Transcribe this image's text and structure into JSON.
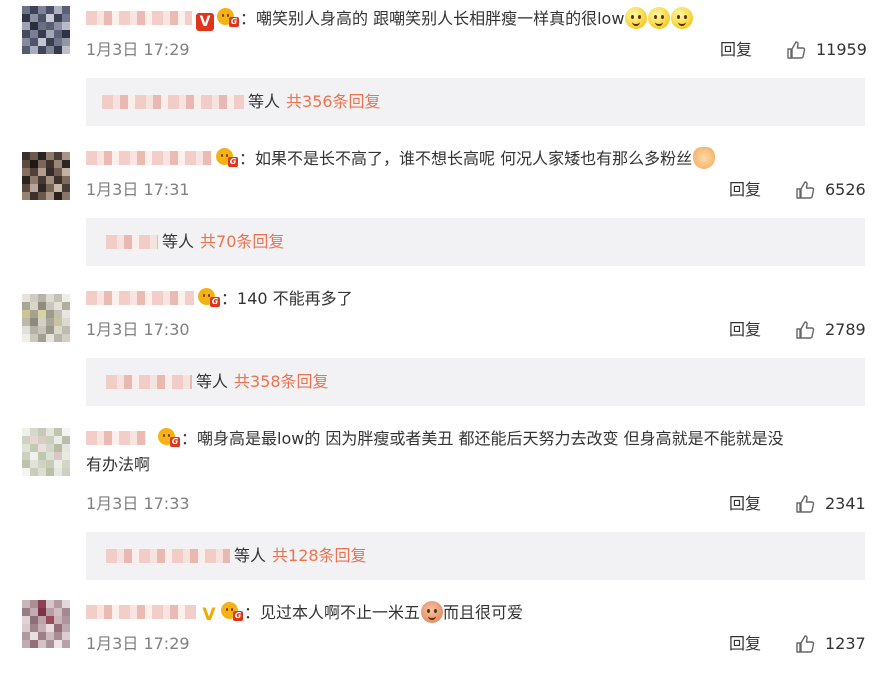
{
  "comments": [
    {
      "text": "嘲笑别人身高的 跟嘲笑别人长相胖瘦一样真的很low",
      "time": "1月3日 17:29",
      "reply_label": "回复",
      "likes": "11959",
      "sub": {
        "suffix": "等人",
        "total": "共356条回复"
      }
    },
    {
      "text": "如果不是长不高了，谁不想长高呢 何况人家矮也有那么多粉丝",
      "time": "1月3日 17:31",
      "reply_label": "回复",
      "likes": "6526",
      "sub": {
        "suffix": "等人",
        "total": "共70条回复"
      }
    },
    {
      "text": "140 不能再多了",
      "time": "1月3日 17:30",
      "reply_label": "回复",
      "likes": "2789",
      "sub": {
        "suffix": "等人",
        "total": "共358条回复"
      }
    },
    {
      "text_line1": "嘲身高是最low的  因为胖瘦或者美丑  都还能后天努力去改变  但身高就是不能就是没",
      "text_line2": "有办法啊",
      "time": "1月3日 17:33",
      "reply_label": "回复",
      "likes": "2341",
      "sub": {
        "suffix": "等人",
        "total": "共128条回复"
      }
    },
    {
      "text_a": "见过本人啊不止一米五",
      "text_b": "而且很可爱",
      "time": "1月3日 17:29",
      "reply_label": "回复",
      "likes": "1237"
    }
  ],
  "verified_badge": "V",
  "colors": {
    "link": "#eb7350",
    "meta": "#808080",
    "sub_bg": "#f2f2f5"
  },
  "icons": [
    "thumbs-up-icon",
    "fan-badge-icon",
    "verified-badge-icon",
    "emoji-icon"
  ]
}
